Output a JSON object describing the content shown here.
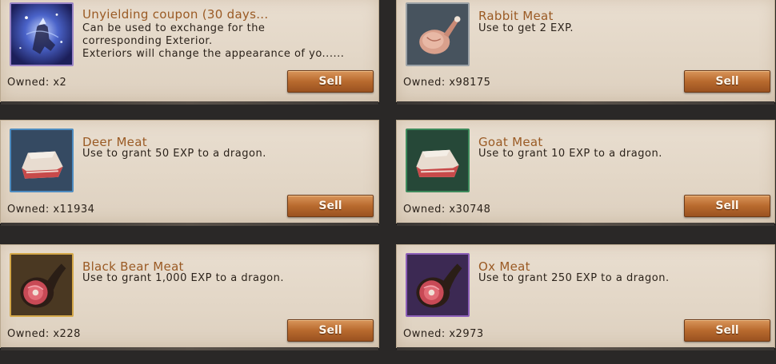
{
  "items": [
    {
      "icon": "unyielding-coupon-icon",
      "title": "Unyielding coupon (30 days...",
      "description": "Can be used to exchange for the\ncorresponding Exterior.\nExteriors will change the appearance of yo......",
      "owned": "Owned: x2",
      "sell_label": "Sell",
      "frame_color": "#9a84c6"
    },
    {
      "icon": "rabbit-meat-icon",
      "title": "Rabbit Meat",
      "description": "Use to get 2 EXP.",
      "owned": "Owned: x98175",
      "sell_label": "Sell",
      "frame_color": "#9aa1a6"
    },
    {
      "icon": "deer-meat-icon",
      "title": "Deer Meat",
      "description": "Use to grant 50 EXP to a dragon.",
      "owned": "Owned: x11934",
      "sell_label": "Sell",
      "frame_color": "#4e8cc0"
    },
    {
      "icon": "goat-meat-icon",
      "title": "Goat Meat",
      "description": "Use to grant 10 EXP to a dragon.",
      "owned": "Owned: x30748",
      "sell_label": "Sell",
      "frame_color": "#3d8a5c"
    },
    {
      "icon": "black-bear-meat-icon",
      "title": "Black Bear Meat",
      "description": "Use to grant 1,000 EXP to a dragon.",
      "owned": "Owned: x228",
      "sell_label": "Sell",
      "frame_color": "#d4a84a"
    },
    {
      "icon": "ox-meat-icon",
      "title": "Ox Meat",
      "description": "Use to grant 250 EXP to a dragon.",
      "owned": "Owned: x2973",
      "sell_label": "Sell",
      "frame_color": "#8c5fb8"
    }
  ]
}
